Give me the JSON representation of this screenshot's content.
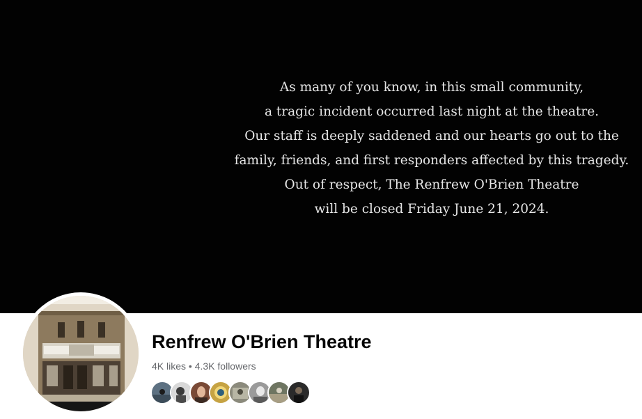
{
  "cover": {
    "message_lines": [
      "As many of you know, in this small community,",
      "a tragic incident occurred last night at the theatre.",
      "Our staff is deeply saddened and our hearts go out to the",
      "family, friends, and first responders affected by this tragedy.",
      "Out of respect, The Renfrew O'Brien Theatre",
      "will be closed Friday June 21, 2024."
    ]
  },
  "profile": {
    "name": "Renfrew O'Brien Theatre",
    "likes": "4K likes",
    "separator": "•",
    "followers": "4.3K followers",
    "avatar_icon": "theatre-building-photo"
  },
  "follower_avatars": [
    {
      "label": "follower-avatar-1",
      "color": "#5d7182"
    },
    {
      "label": "follower-avatar-2",
      "color": "#d8d8d8"
    },
    {
      "label": "follower-avatar-3",
      "color": "#7a4a36"
    },
    {
      "label": "follower-avatar-4",
      "color": "#c6a343"
    },
    {
      "label": "follower-avatar-5",
      "color": "#8b8a7c"
    },
    {
      "label": "follower-avatar-6",
      "color": "#9a9a9a"
    },
    {
      "label": "follower-avatar-7",
      "color": "#6e7561"
    },
    {
      "label": "follower-avatar-8",
      "color": "#2a2a2a"
    }
  ]
}
